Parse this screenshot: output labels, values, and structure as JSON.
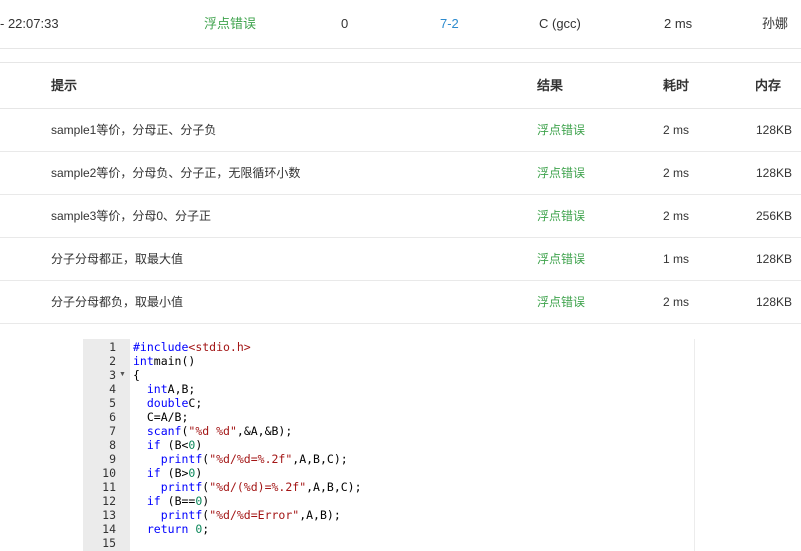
{
  "submission": {
    "time": "- 22:07:33",
    "status": "浮点错误",
    "score": "0",
    "problem": "7-2",
    "language": "C (gcc)",
    "time_used": "2 ms",
    "user": "孙娜"
  },
  "table": {
    "headers": {
      "hint": "提示",
      "result": "结果",
      "time": "耗时",
      "memory": "内存"
    },
    "rows": [
      {
        "hint": "sample1等价，分母正、分子负",
        "result": "浮点错误",
        "time": "2 ms",
        "memory": "128KB"
      },
      {
        "hint": "sample2等价，分母负、分子正，无限循环小数",
        "result": "浮点错误",
        "time": "2 ms",
        "memory": "128KB"
      },
      {
        "hint": "sample3等价，分母0、分子正",
        "result": "浮点错误",
        "time": "2 ms",
        "memory": "256KB"
      },
      {
        "hint": "分子分母都正，取最大值",
        "result": "浮点错误",
        "time": "1 ms",
        "memory": "128KB"
      },
      {
        "hint": "分子分母都负，取最小值",
        "result": "浮点错误",
        "time": "2 ms",
        "memory": "128KB"
      }
    ]
  },
  "colors": {
    "accepted_green": "#3fa34d",
    "link_blue": "#2d8bce",
    "keyword_blue": "#0000ff",
    "string_red": "#a31515",
    "number_green": "#098658"
  },
  "editor": {
    "fold_icon": "fold-arrow-icon",
    "lines": [
      [
        [
          "pp",
          "#include"
        ],
        [
          "str",
          "<stdio.h>"
        ]
      ],
      [
        [
          "kw",
          "int"
        ],
        [
          "",
          "main()"
        ]
      ],
      [
        [
          "",
          "{"
        ]
      ],
      [
        [
          "",
          "  "
        ],
        [
          "kw",
          "int"
        ],
        [
          "",
          "A,B;"
        ]
      ],
      [
        [
          "",
          "  "
        ],
        [
          "kw",
          "double"
        ],
        [
          "",
          "C;"
        ]
      ],
      [
        [
          "",
          "  C=A/B;"
        ]
      ],
      [
        [
          "",
          "  "
        ],
        [
          "kw",
          "scanf"
        ],
        [
          "",
          "("
        ],
        [
          "str",
          "\"%d %d\""
        ],
        [
          "",
          ",&A,&B);"
        ]
      ],
      [
        [
          "",
          "  "
        ],
        [
          "kw",
          "if"
        ],
        [
          "",
          " (B<"
        ],
        [
          "num",
          "0"
        ],
        [
          "",
          ")"
        ]
      ],
      [
        [
          "",
          "    "
        ],
        [
          "kw",
          "printf"
        ],
        [
          "",
          "("
        ],
        [
          "str",
          "\"%d/%d=%.2f\""
        ],
        [
          "",
          ",A,B,C);"
        ]
      ],
      [
        [
          "",
          "  "
        ],
        [
          "kw",
          "if"
        ],
        [
          "",
          " (B>"
        ],
        [
          "num",
          "0"
        ],
        [
          "",
          ")"
        ]
      ],
      [
        [
          "",
          "    "
        ],
        [
          "kw",
          "printf"
        ],
        [
          "",
          "("
        ],
        [
          "str",
          "\"%d/(%d)=%.2f\""
        ],
        [
          "",
          ",A,B,C);"
        ]
      ],
      [
        [
          "",
          "  "
        ],
        [
          "kw",
          "if"
        ],
        [
          "",
          " (B=="
        ],
        [
          "num",
          "0"
        ],
        [
          "",
          ")"
        ]
      ],
      [
        [
          "",
          "    "
        ],
        [
          "kw",
          "printf"
        ],
        [
          "",
          "("
        ],
        [
          "str",
          "\"%d/%d=Error\""
        ],
        [
          "",
          ",A,B);"
        ]
      ],
      [
        [
          "",
          "  "
        ],
        [
          "kw",
          "return"
        ],
        [
          "",
          " "
        ],
        [
          "num",
          "0"
        ],
        [
          "",
          ";"
        ]
      ],
      [
        [
          "",
          ""
        ]
      ]
    ]
  }
}
